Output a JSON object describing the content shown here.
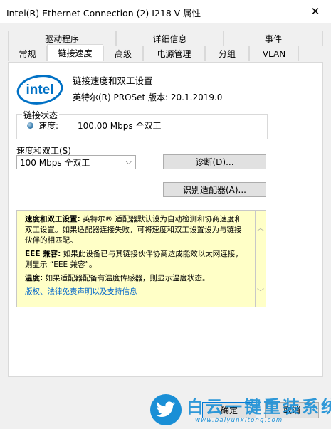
{
  "window": {
    "title": "Intel(R) Ethernet Connection (2) I218-V 属性",
    "close_glyph": "✕"
  },
  "tabs": {
    "back_row": [
      "驱动程序",
      "详细信息",
      "事件"
    ],
    "front_row": [
      "常规",
      "链接速度",
      "高级",
      "电源管理",
      "分组",
      "VLAN"
    ],
    "active": "链接速度"
  },
  "panel": {
    "logo_text": "intel",
    "heading": "链接速度和双工设置",
    "version": "英特尔(R) PROSet 版本: 20.1.2019.0",
    "link_status": {
      "legend": "链接状态",
      "speed_label": "速度:",
      "speed_value": "100.00 Mbps 全双工"
    },
    "speed_duplex": {
      "label": "速度和双工(S)",
      "selected": "100 Mbps 全双工"
    },
    "buttons": {
      "diagnose": "诊断(D)...",
      "identify": "识别适配器(A)..."
    },
    "help": {
      "p1_bold": "速度和双工设置:",
      "p1_text": " 英特尔® 适配器默认设为自动检测和协商速度和双工设置。如果适配器连接失败，可将速度和双工设置设为与链接伙伴的相匹配。",
      "p2_bold": "EEE 兼容:",
      "p2_text": " 如果此设备已与其链接伙伴协商达成能效以太网连接，则显示 “EEE 兼容”。",
      "p3_bold": "温度:",
      "p3_text": " 如果适配器配备有温度传感器，则显示温度状态。",
      "link": "版权、法律免责声明以及支持信息"
    }
  },
  "footer": {
    "ok": "确定",
    "cancel": "取消"
  },
  "watermark": {
    "text": "白云一键重装系统",
    "url": "www.baiyunxitong.com"
  }
}
